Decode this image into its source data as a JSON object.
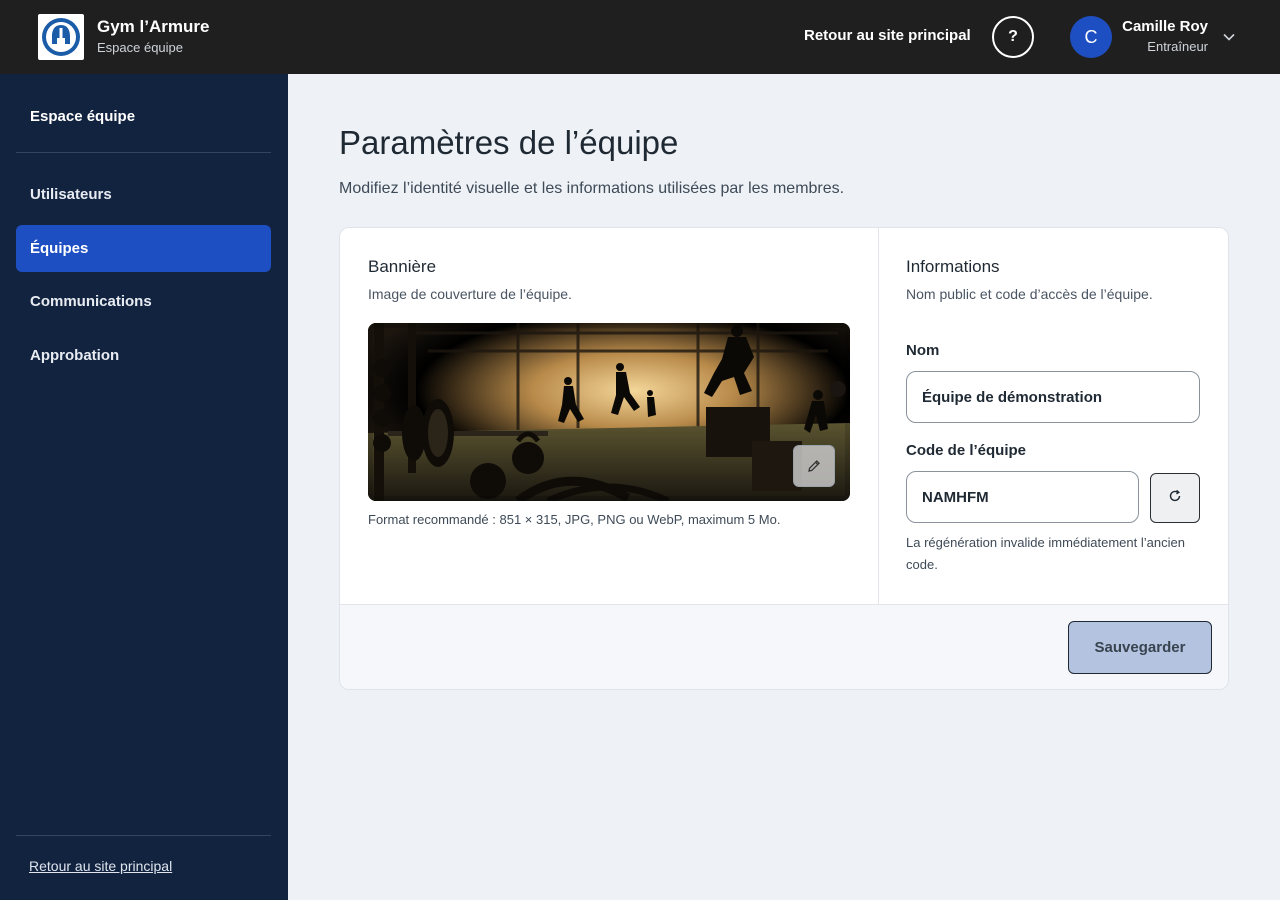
{
  "header": {
    "brand_title": "Gym l’Armure",
    "brand_subtitle": "Espace équipe",
    "back_link": "Retour au site principal",
    "help_label": "?",
    "user": {
      "initial": "C",
      "name": "Camille Roy",
      "role": "Entraîneur"
    }
  },
  "sidebar": {
    "heading": "Espace équipe",
    "items": [
      {
        "label": "Utilisateurs",
        "active": false
      },
      {
        "label": "Équipes",
        "active": true
      },
      {
        "label": "Communications",
        "active": false
      },
      {
        "label": "Approbation",
        "active": false
      }
    ],
    "bottom_link": "Retour au site principal"
  },
  "main": {
    "title": "Paramètres de l’équipe",
    "description": "Modifiez l’identité visuelle et les informations utilisées par les membres.",
    "banner": {
      "title": "Bannière",
      "description": "Image de couverture de l’équipe.",
      "hint": "Format recommandé : 851 × 315, JPG, PNG ou WebP, maximum 5 Mo."
    },
    "info": {
      "title": "Informations",
      "description": "Nom public et code d’accès de l’équipe.",
      "name_label": "Nom",
      "name_value": "Équipe de démonstration",
      "code_label": "Code de l’équipe",
      "code_value": "NAMHFM",
      "regen_note": "La régénération invalide immédiatement l’ancien code."
    },
    "save_label": "Sauvegarder"
  },
  "colors": {
    "topbar": "#1f1f1f",
    "sidebar": "#12233f",
    "accent": "#1e4fc2",
    "page_bg": "#eef2f6",
    "save_button": "#b3c3e0"
  },
  "icons": {
    "logo": "armor-helmet-logo",
    "help": "question-mark-icon",
    "caret": "chevron-down-icon",
    "edit": "pencil-icon",
    "regenerate": "refresh-icon"
  }
}
